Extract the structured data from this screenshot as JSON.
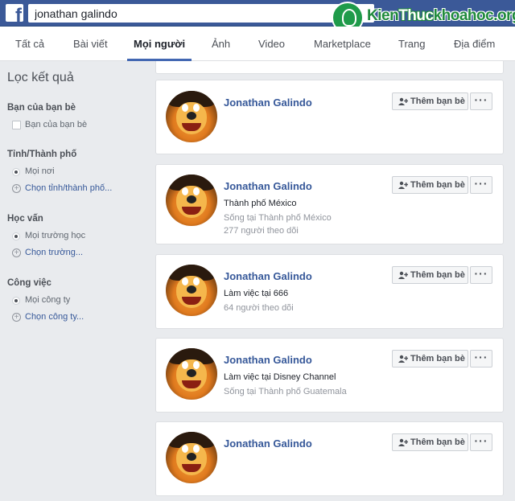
{
  "search": {
    "value": "jonathan galindo"
  },
  "watermark": {
    "part1": "Kien",
    "part2": "Thuc",
    "part3": "khoahoc.org"
  },
  "tabs": [
    {
      "label": "Tất cả"
    },
    {
      "label": "Bài viết"
    },
    {
      "label": "Mọi người"
    },
    {
      "label": "Ảnh"
    },
    {
      "label": "Video"
    },
    {
      "label": "Marketplace"
    },
    {
      "label": "Trang"
    },
    {
      "label": "Địa điểm"
    }
  ],
  "sidebar": {
    "title": "Lọc kết quả",
    "friends": {
      "heading": "Bạn của bạn bè",
      "option": "Bạn của bạn bè"
    },
    "city": {
      "heading": "Tỉnh/Thành phố",
      "selected": "Mọi nơi",
      "choose": "Chọn tỉnh/thành phố..."
    },
    "education": {
      "heading": "Học vấn",
      "selected": "Mọi trường học",
      "choose": "Chọn trường..."
    },
    "work": {
      "heading": "Công việc",
      "selected": "Mọi công ty",
      "choose": "Chọn công ty..."
    }
  },
  "results": [
    {
      "name": "Jonathan Galindo",
      "line1": "",
      "line2": "",
      "line3": ""
    },
    {
      "name": "Jonathan Galindo",
      "line1": "Thành phố México",
      "line2": "Sống tại Thành phố México",
      "line3": "277 người theo dõi"
    },
    {
      "name": "Jonathan Galindo",
      "line1": "Làm việc tại 666",
      "line2": "64 người theo dõi",
      "line3": ""
    },
    {
      "name": "Jonathan Galindo",
      "line1": "Làm việc tại Disney Channel",
      "line2": "Sống tại Thành phố Guatemala",
      "line3": ""
    },
    {
      "name": "Jonathan Galindo",
      "line1": "",
      "line2": "",
      "line3": ""
    }
  ],
  "actions": {
    "add_friend": "Thêm bạn bè",
    "more": "···"
  },
  "colors": {
    "brand": "#3b5998",
    "link": "#365899",
    "background": "#e9ebee"
  }
}
